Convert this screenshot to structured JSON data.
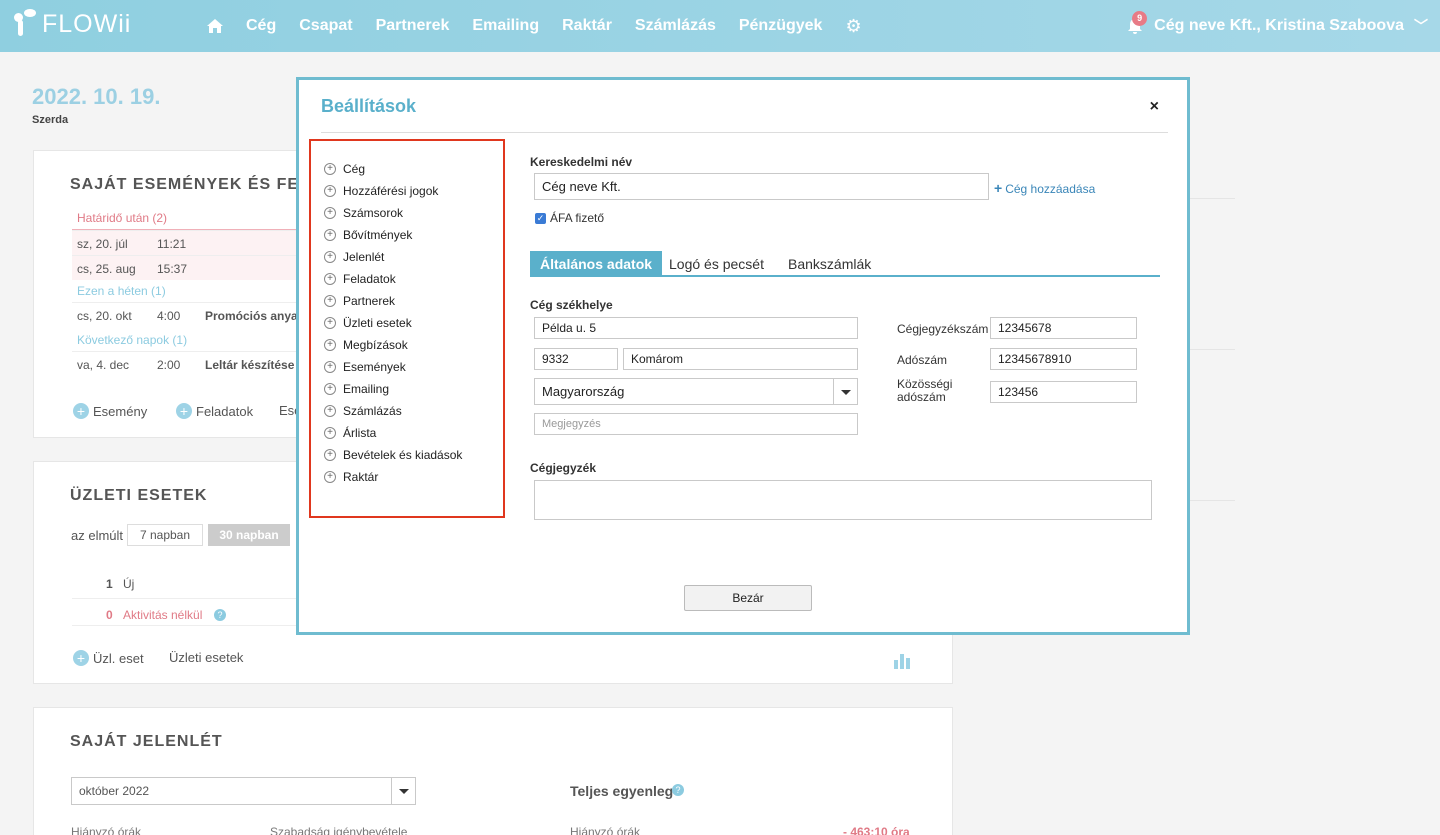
{
  "app": {
    "logo": "FLOWii"
  },
  "nav": {
    "items": [
      "Cég",
      "Csapat",
      "Partnerek",
      "Emailing",
      "Raktár",
      "Számlázás",
      "Pénzügyek"
    ],
    "notification_count": "9",
    "user_label": "Cég neve Kft., Kristina Szaboova"
  },
  "dashboard": {
    "date": "2022. 10. 19.",
    "weekday": "Szerda",
    "events": {
      "title": "SAJÁT ESEMÉNYEK ÉS FELA",
      "overdue_head": "Határidő után (2)",
      "overdue": [
        {
          "day": "sz, 20. júl",
          "time": "11:21",
          "title": ""
        },
        {
          "day": "cs, 25. aug",
          "time": "15:37",
          "title": ""
        }
      ],
      "week_head": "Ezen a héten (1)",
      "week": [
        {
          "day": "cs, 20. okt",
          "time": "4:00",
          "title": "Promóciós anyag"
        }
      ],
      "next_head": "Következő napok (1)",
      "next": [
        {
          "day": "va, 4. dec",
          "time": "2:00",
          "title": "Leltár készítése"
        }
      ],
      "btn_event": "Esemény",
      "btn_tasks": "Feladatok",
      "btn_more": "Ese"
    },
    "business": {
      "title": "ÜZLETI ESETEK",
      "period_label": "az elmúlt",
      "period_7": "7 napban",
      "period_30": "30 napban",
      "new_count": "1",
      "new_label": "Új",
      "inactive_count": "0",
      "inactive_label": "Aktivitás nélkül",
      "btn_add": "Üzl. eset",
      "link_cases": "Üzleti esetek"
    },
    "attendance": {
      "title": "SAJÁT JELENLÉT",
      "month_select": "október 2022",
      "balance_title": "Teljes egyenleg",
      "missing_hours": "Hiányzó órák",
      "leave_request": "Szabadság igénybevétele",
      "missing_hours_2": "Hiányzó órák",
      "missing_value": "- 463:10 óra"
    }
  },
  "modal": {
    "title": "Beállítások",
    "close_icon": "×",
    "menu": [
      "Cég",
      "Hozzáférési jogok",
      "Számsorok",
      "Bővítmények",
      "Jelenlét",
      "Feladatok",
      "Partnerek",
      "Üzleti esetek",
      "Megbízások",
      "Események",
      "Emailing",
      "Számlázás",
      "Árlista",
      "Bevételek és kiadások",
      "Raktár"
    ],
    "trade_name_label": "Kereskedelmi név",
    "trade_name_value": "Cég neve Kft.",
    "add_company": "Cég hozzáadása",
    "vat_payer": "ÁFA fizető",
    "tabs": [
      "Általános adatok",
      "Logó és pecsét",
      "Bankszámlák"
    ],
    "hq_label": "Cég székhelye",
    "street": "Példa u. 5",
    "zip": "9332",
    "city": "Komárom",
    "country": "Magyarország",
    "note_placeholder": "Megjegyzés",
    "reg_no_label": "Cégjegyzékszám",
    "reg_no": "12345678",
    "tax_no_label": "Adószám",
    "tax_no": "12345678910",
    "eu_tax_label_1": "Közösségi",
    "eu_tax_label_2": "adószám",
    "eu_tax_no": "123456",
    "registry_label": "Cégjegyzék",
    "close_button": "Bezár"
  }
}
